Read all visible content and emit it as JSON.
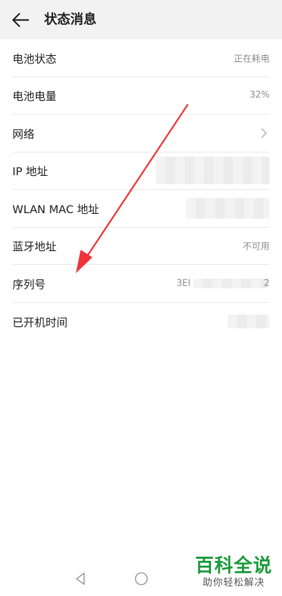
{
  "header": {
    "title": "状态消息",
    "back_icon": "arrow-left-icon"
  },
  "rows": [
    {
      "label": "电池状态",
      "value": "正在耗电"
    },
    {
      "label": "电池电量",
      "value": "32%"
    },
    {
      "label": "网络",
      "value": ""
    },
    {
      "label": "IP 地址",
      "value": ""
    },
    {
      "label": "WLAN MAC 地址",
      "value": ""
    },
    {
      "label": "蓝牙地址",
      "value": "不可用"
    },
    {
      "label": "序列号",
      "value_prefix": "3EI",
      "value_suffix": "2"
    },
    {
      "label": "已开机时间",
      "value": ""
    }
  ],
  "annotation": {
    "color": "#f0343a"
  },
  "watermark": {
    "logo": "百科全说",
    "tagline": "助你轻松解决",
    "color": "#1a9a3a"
  },
  "navbar": {
    "back_icon": "triangle-back-icon",
    "home_icon": "circle-home-icon"
  }
}
